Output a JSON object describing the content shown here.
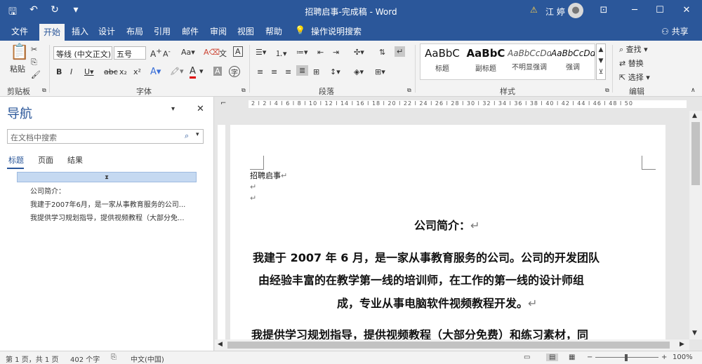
{
  "window": {
    "title": "招聘启事-完成稿 - Word",
    "user": "江 婷",
    "share": "共享"
  },
  "ribbon_tabs": [
    "文件",
    "开始",
    "插入",
    "设计",
    "布局",
    "引用",
    "邮件",
    "审阅",
    "视图",
    "帮助",
    "操作说明搜索"
  ],
  "clipboard": {
    "paste": "粘贴",
    "group": "剪贴板"
  },
  "font": {
    "name": "等线 (中文正文)",
    "size": "五号",
    "group": "字体"
  },
  "paragraph": {
    "group": "段落"
  },
  "styles": {
    "group": "样式",
    "items": [
      {
        "sample": "AaBbC",
        "name": "标题"
      },
      {
        "sample": "AaBbC",
        "name": "副标题"
      },
      {
        "sample": "AaBbCcDd",
        "name": "不明显强调"
      },
      {
        "sample": "AaBbCcDd",
        "name": "强调"
      }
    ]
  },
  "editing": {
    "group": "编辑",
    "find": "查找",
    "replace": "替换",
    "select": "选择"
  },
  "nav": {
    "title": "导航",
    "search_placeholder": "在文档中搜索",
    "tabs": [
      "标题",
      "页面",
      "结果"
    ],
    "headings": [
      "公司简介：",
      "我建于2007年6月，是一家从事教育服务的公司...",
      "我提供学习规划指导，提供视频教程（大部分免..."
    ]
  },
  "ruler_text": "2  l  2  l  4  l  6  l  8  l  10  l  12  l  14  l  16  l  18  l  20  l  22  l  24  l  26  l  28  l  30  l  32  l  34  l  36  l  38  l  40  l  42  l  44  l  46  l  48  l  50",
  "document": {
    "header": "招聘启事",
    "heading": "公司简介：",
    "para1": [
      "我建于 2007 年 6 月，是一家从事教育服务的公司。公司的开发团队",
      "由经验丰富的在教学第一线的培训师，在工作的第一线的设计师组",
      "成，专业从事电脑软件视频教程开发。"
    ],
    "para2": "我提供学习规划指导，提供视频教程（大部分免费）和练习素材，同"
  },
  "status": {
    "page": "第 1 页，共 1 页",
    "words": "402 个字",
    "lang": "中文(中国)",
    "zoom": "100%"
  }
}
